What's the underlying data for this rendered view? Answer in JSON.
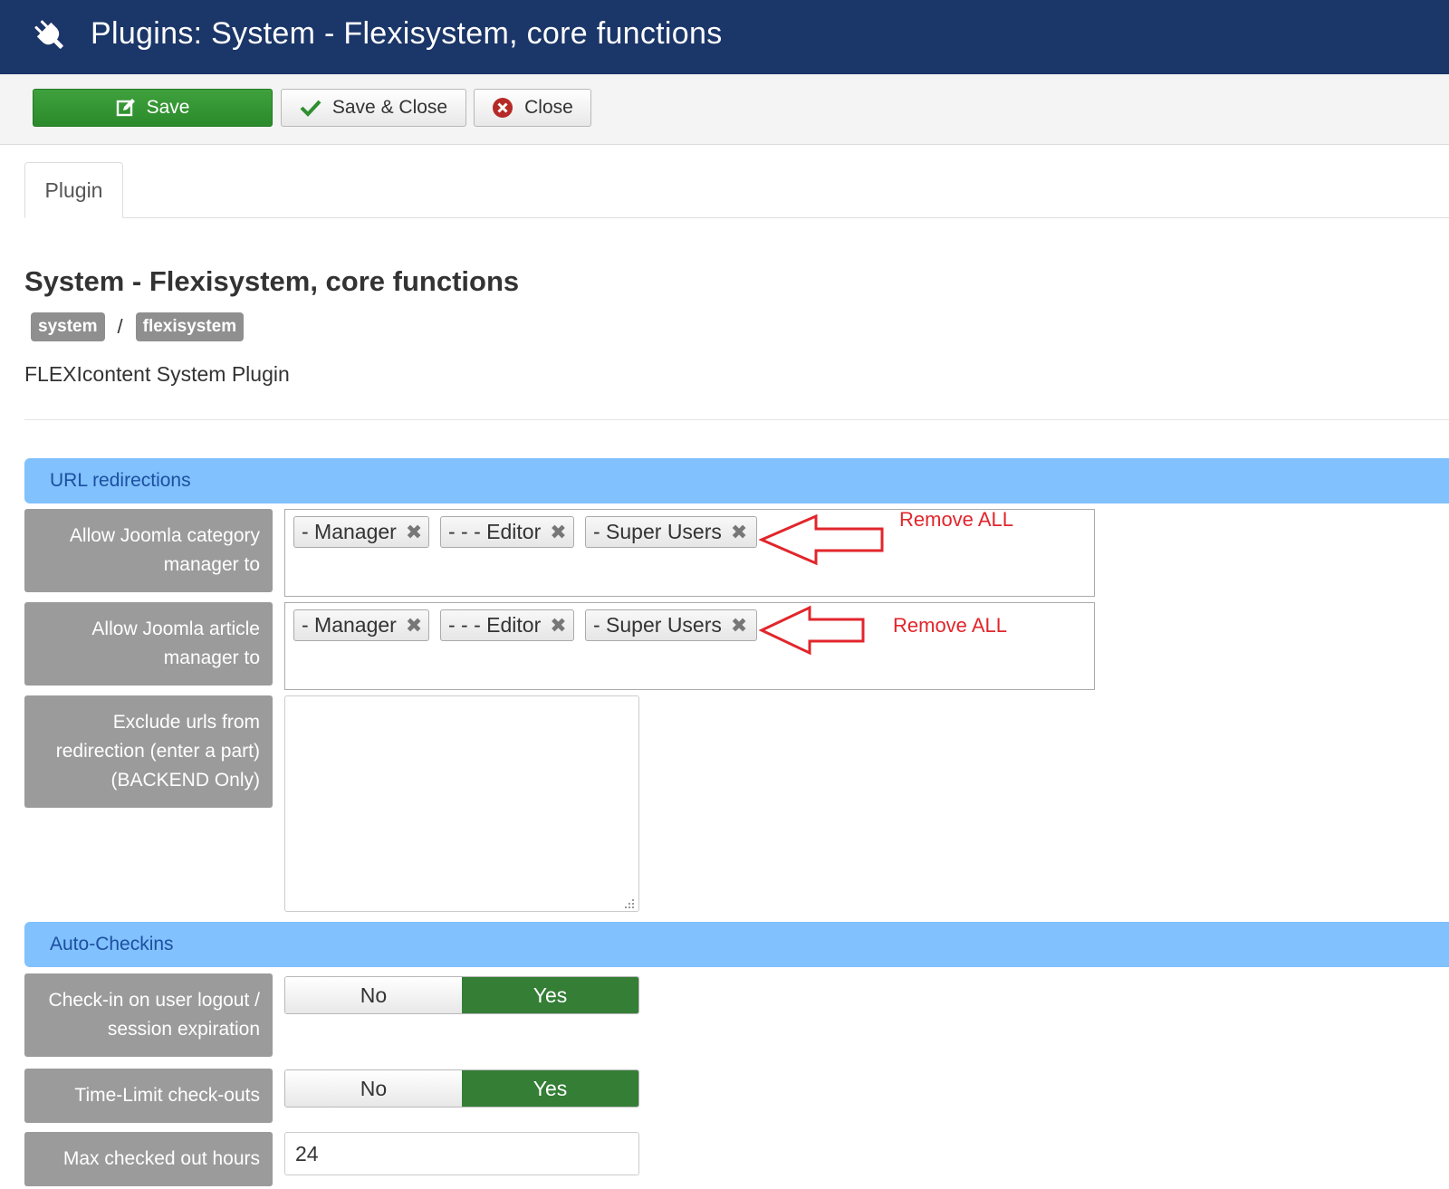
{
  "header": {
    "title": "Plugins: System - Flexisystem, core functions",
    "icon": "plug-icon"
  },
  "toolbar": {
    "save_label": "Save",
    "save_close_label": "Save & Close",
    "close_label": "Close"
  },
  "tabs": [
    {
      "label": "Plugin"
    }
  ],
  "plugin": {
    "title": "System - Flexisystem, core functions",
    "badges": [
      "system",
      "flexisystem"
    ],
    "separator": "/",
    "description": "FLEXIcontent System Plugin"
  },
  "sections": {
    "url_redirections": "URL redirections",
    "auto_checkins": "Auto-Checkins"
  },
  "fields": {
    "category_manager": {
      "label_line1": "Allow Joomla category",
      "label_line2": "manager to",
      "chips": [
        "- Manager",
        "- - - Editor",
        "- Super Users"
      ]
    },
    "article_manager": {
      "label_line1": "Allow Joomla article",
      "label_line2": "manager to",
      "chips": [
        "- Manager",
        "- - - Editor",
        "- Super Users"
      ]
    },
    "exclude_urls": {
      "label_line1": "Exclude urls from",
      "label_line2": "redirection (enter a part)",
      "label_line3": "(BACKEND Only)",
      "value": ""
    },
    "checkin_logout": {
      "label_line1": "Check-in on user logout /",
      "label_line2": "session expiration",
      "no": "No",
      "yes": "Yes",
      "selected": "Yes"
    },
    "time_limit": {
      "label": "Time-Limit check-outs",
      "no": "No",
      "yes": "Yes",
      "selected": "Yes"
    },
    "max_hours": {
      "label": "Max checked out hours",
      "value": "24"
    }
  },
  "annotations": {
    "remove_all_1": "Remove ALL",
    "remove_all_2": "Remove ALL"
  },
  "colors": {
    "header_bg": "#1b3668",
    "save_green": "#2b8a2b",
    "section_blue": "#80c1fe",
    "label_gray": "#9b9b9b",
    "toggle_yes": "#347e36",
    "annotation_red": "#e1262c"
  }
}
